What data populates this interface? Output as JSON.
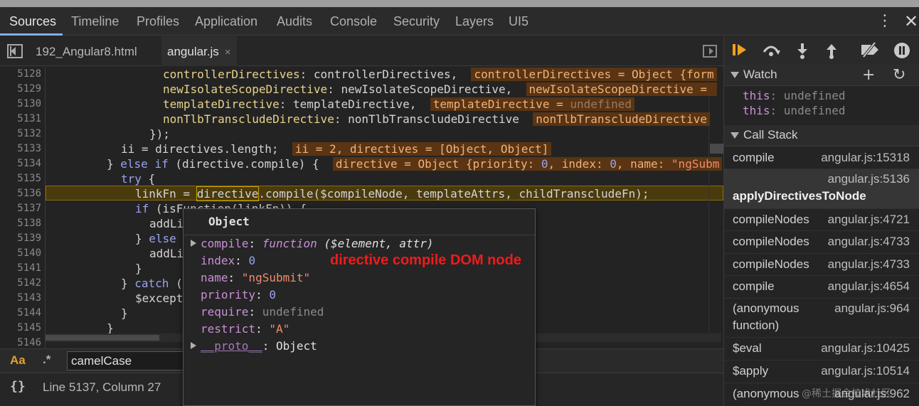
{
  "tabs": [
    "Sources",
    "Timeline",
    "Profiles",
    "Application",
    "Audits",
    "Console",
    "Security",
    "Layers",
    "UI5"
  ],
  "file_tabs": {
    "inactive": "192_Angular8.html",
    "active": "angular.js",
    "close_glyph": "×"
  },
  "icons": {
    "kebab": "⋮",
    "close": "✕",
    "resume": "resume-icon",
    "step_over": "step-over-icon",
    "step_into": "step-into-icon",
    "step_out": "step-out-icon",
    "deactivate": "deactivate-breakpoints-icon",
    "pause_exceptions": "pause-on-exceptions-icon"
  },
  "editor": {
    "line_numbers": [
      "5128",
      "5129",
      "5130",
      "5131",
      "5132",
      "5133",
      "5134",
      "5135",
      "5136",
      "5137",
      "5138",
      "5139",
      "5140",
      "5141",
      "5142",
      "5143",
      "5144",
      "5145",
      "5146"
    ],
    "lines": {
      "l5128_a": "controllerDirectives",
      "l5128_b": ": controllerDirectives,",
      "l5128_inl": "controllerDirectives = Object {form",
      "l5129_a": "newIsolateScopeDirective",
      "l5129_b": ": newIsolateScopeDirective,",
      "l5129_inl": "newIsolateScopeDirective = ",
      "l5130_a": "templateDirective",
      "l5130_b": ": templateDirective,",
      "l5130_inl_a": "templateDirective = ",
      "l5130_inl_b": "undefined",
      "l5131_a": "nonTlbTranscludeDirective",
      "l5131_b": ": nonTlbTranscludeDirective",
      "l5131_inl": "nonTlbTranscludeDirective",
      "l5132": "});",
      "l5133": "ii = directives.length;",
      "l5133_inl": "ii = 2, directives = [Object, Object]",
      "l5134_a": "} ",
      "l5134_else": "else",
      "l5134_if": "if",
      "l5134_b": " (directive.compile) {",
      "l5134_inl_a": "directive = Object {priority: ",
      "l5134_inl_n1": "0",
      "l5134_inl_b": ", index: ",
      "l5134_inl_n2": "0",
      "l5134_inl_c": ", name: ",
      "l5134_inl_s": "\"ngSubm",
      "l5135": "try",
      "l5135_b": " {",
      "l5136_a": "linkFn = ",
      "l5136_dir": "directive",
      "l5136_b": ".compile($compileNode, templateAttrs, childTranscludeFn);",
      "l5137_if": "if",
      "l5137_b": " (isFunction(linkFn)) {",
      "l5138": "addLi",
      "l5139_a": "} ",
      "l5139_else": "else",
      "l5140": "addLi",
      "l5141": "}",
      "l5142_a": "} ",
      "l5142_catch": "catch",
      "l5142_b": " (",
      "l5143": "$except",
      "l5144": "}",
      "l5145": "}"
    }
  },
  "search": {
    "match_case": "Aa",
    "regex": ".*",
    "value": "camelCase"
  },
  "status": {
    "braces": "{}",
    "position": "Line 5137, Column 27"
  },
  "popover": {
    "title": "Object",
    "rows": [
      {
        "key": "compile",
        "sep": ": ",
        "fn": "function",
        "args": " ($element, attr)"
      },
      {
        "key": "index",
        "sep": ": ",
        "value": "0"
      },
      {
        "key": "name",
        "sep": ": ",
        "value": "\"ngSubmit\""
      },
      {
        "key": "priority",
        "sep": ": ",
        "value": "0"
      },
      {
        "key": "require",
        "sep": ": ",
        "value": "undefined"
      },
      {
        "key": "restrict",
        "sep": ": ",
        "value": "\"A\""
      },
      {
        "key": "__proto__",
        "sep": ": ",
        "value": "Object"
      }
    ],
    "annotation": "directive compile DOM node"
  },
  "watch": {
    "title": "Watch",
    "add": "+",
    "refresh": "↻",
    "items": [
      {
        "key": "this",
        "sep": ": ",
        "value": "undefined"
      },
      {
        "key": "this",
        "sep": ": ",
        "value": "undefined"
      }
    ]
  },
  "call_stack": {
    "title": "Call Stack",
    "frames": [
      {
        "name": "compile",
        "location": "angular.js:15318"
      },
      {
        "name": "applyDirectivesToNode",
        "location": "angular.js:5136"
      },
      {
        "name": "compileNodes",
        "location": "angular.js:4721"
      },
      {
        "name": "compileNodes",
        "location": "angular.js:4733"
      },
      {
        "name": "compileNodes",
        "location": "angular.js:4733"
      },
      {
        "name": "compile",
        "location": "angular.js:4654"
      },
      {
        "name": "(anonymous",
        "name2": "function)",
        "location": "angular.js:964"
      },
      {
        "name": "$eval",
        "location": "angular.js:10425"
      },
      {
        "name": "$apply",
        "location": "angular.js:10514"
      },
      {
        "name": "(anonymous",
        "location": "angular.js:962"
      }
    ]
  },
  "watermark": "@稀土掘金技术社区"
}
